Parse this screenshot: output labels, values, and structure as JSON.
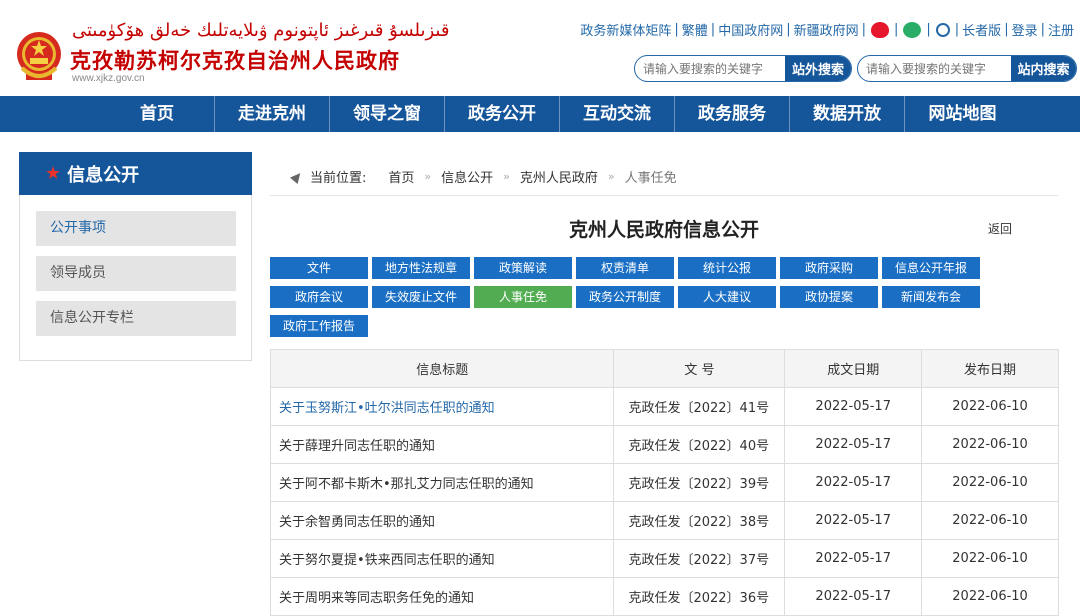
{
  "header": {
    "uyghur_title": "قىزىلسۇ قىرغىز ئاپتونوم ۋىلايەتلىك خەلق ھۆكۈمىتى",
    "site_title": "克孜勒苏柯尔克孜自治州人民政府",
    "site_url": "www.xjkz.gov.cn",
    "top_links": [
      "政务新媒体矩阵",
      "繁體",
      "中国政府网",
      "新疆政府网",
      "长者版",
      "登录",
      "注册"
    ],
    "search_outer": {
      "placeholder": "请输入要搜索的关键字",
      "button": "站外搜索"
    },
    "search_inner": {
      "placeholder": "请输入要搜索的关键字",
      "button": "站内搜索"
    }
  },
  "nav": [
    "首页",
    "走进克州",
    "领导之窗",
    "政务公开",
    "互动交流",
    "政务服务",
    "数据开放",
    "网站地图"
  ],
  "sidebar": {
    "title": "信息公开",
    "items": [
      "公开事项",
      "领导成员",
      "信息公开专栏"
    ]
  },
  "breadcrumb": {
    "label": "当前位置:",
    "items": [
      "首页",
      "信息公开",
      "克州人民政府",
      "人事任免"
    ]
  },
  "main": {
    "title": "克州人民政府信息公开",
    "back": "返回",
    "tabs": [
      "文件",
      "地方性法规章",
      "政策解读",
      "权责清单",
      "统计公报",
      "政府采购",
      "信息公开年报",
      "政府会议",
      "失效废止文件",
      "人事任免",
      "政务公开制度",
      "人大建议",
      "政协提案",
      "新闻发布会",
      "政府工作报告"
    ],
    "active_tab": "人事任免",
    "table": {
      "headers": [
        "信息标题",
        "文 号",
        "成文日期",
        "发布日期"
      ],
      "rows": [
        [
          "关于玉努斯江•吐尔洪同志任职的通知",
          "克政任发〔2022〕41号",
          "2022-05-17",
          "2022-06-10"
        ],
        [
          "关于薛理升同志任职的通知",
          "克政任发〔2022〕40号",
          "2022-05-17",
          "2022-06-10"
        ],
        [
          "关于阿不都卡斯木•那扎艾力同志任职的通知",
          "克政任发〔2022〕39号",
          "2022-05-17",
          "2022-06-10"
        ],
        [
          "关于余智勇同志任职的通知",
          "克政任发〔2022〕38号",
          "2022-05-17",
          "2022-06-10"
        ],
        [
          "关于努尔夏提•铁来西同志任职的通知",
          "克政任发〔2022〕37号",
          "2022-05-17",
          "2022-06-10"
        ],
        [
          "关于周明来等同志职务任免的通知",
          "克政任发〔2022〕36号",
          "2022-05-17",
          "2022-06-10"
        ]
      ]
    }
  },
  "colors": {
    "brand_red": "#c40000",
    "nav_blue": "#15559a",
    "tab_blue": "#1a6fc4",
    "tab_active_green": "#52ad52"
  }
}
